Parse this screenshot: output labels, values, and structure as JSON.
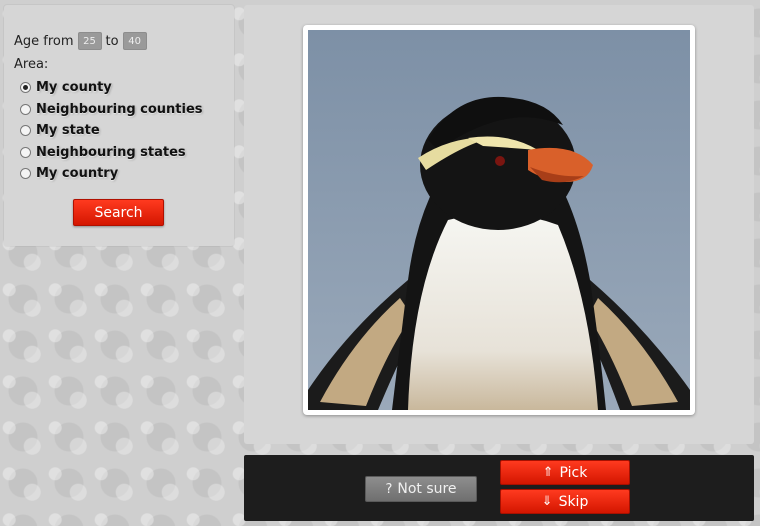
{
  "search": {
    "age_from_label": "Age from",
    "age_from_value": "25",
    "age_to_label": "to",
    "age_to_value": "40",
    "area_label": "Area:",
    "area_options": [
      {
        "label": "My county",
        "selected": true
      },
      {
        "label": "Neighbouring counties",
        "selected": false
      },
      {
        "label": "My state",
        "selected": false
      },
      {
        "label": "Neighbouring states",
        "selected": false
      },
      {
        "label": "My country",
        "selected": false
      }
    ],
    "search_button": "Search"
  },
  "actions": {
    "not_sure_icon": "?",
    "not_sure_label": "Not sure",
    "pick_icon": "⇑",
    "pick_label": "Pick",
    "skip_icon": "⇓",
    "skip_label": "Skip"
  },
  "colors": {
    "accent_red": "#e82408",
    "action_bar": "#1d1d1d",
    "panel": "#d6d6d6"
  }
}
